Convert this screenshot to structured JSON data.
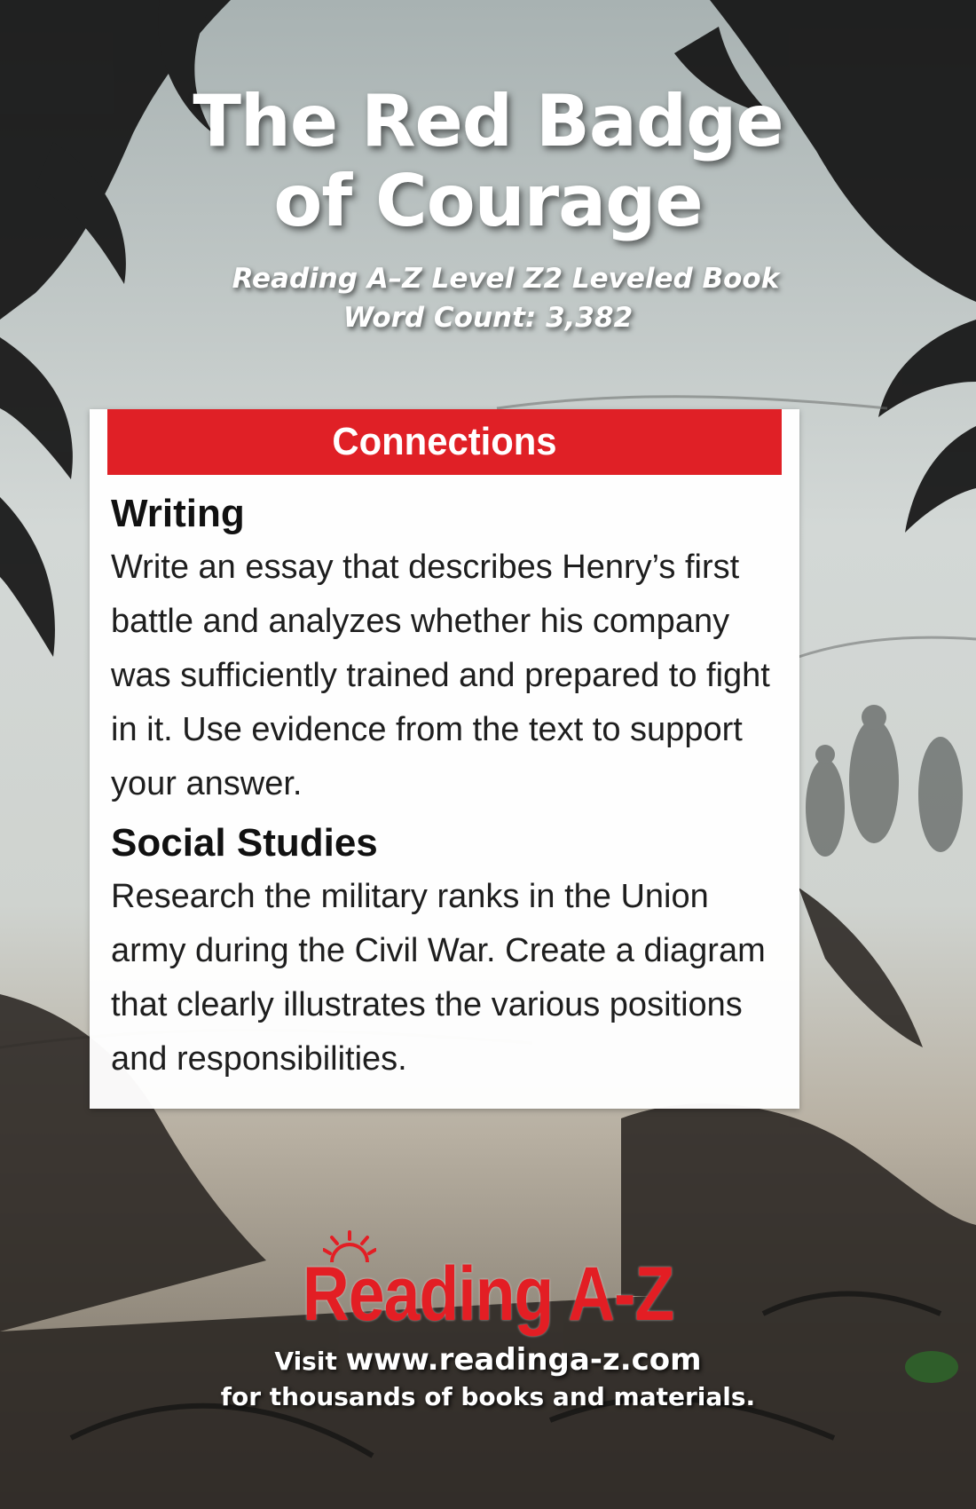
{
  "cover": {
    "title_line1": "The Red Badge",
    "title_line2": "of Courage",
    "level_line": "Reading A–Z Level Z2 Leveled Book",
    "word_count": "Word Count: 3,382"
  },
  "connections": {
    "header": "Connections",
    "sections": [
      {
        "heading": "Writing",
        "text": "Write an essay that describes Henry’s first battle and analyzes whether his company was sufficiently trained and prepared to fight in it. Use evidence from the text to support your answer."
      },
      {
        "heading": "Social Studies",
        "text": "Research the military ranks in the Union army during the Civil War. Create a diagram that clearly illustrates the various positions and responsibilities."
      }
    ]
  },
  "footer": {
    "logo_text": "Reading A-Z",
    "visit_prefix": "Visit",
    "url": "www.readinga-z.com",
    "tagline": "for thousands of books and materials."
  },
  "colors": {
    "accent_red": "#e02026",
    "title_white": "#ffffff"
  }
}
